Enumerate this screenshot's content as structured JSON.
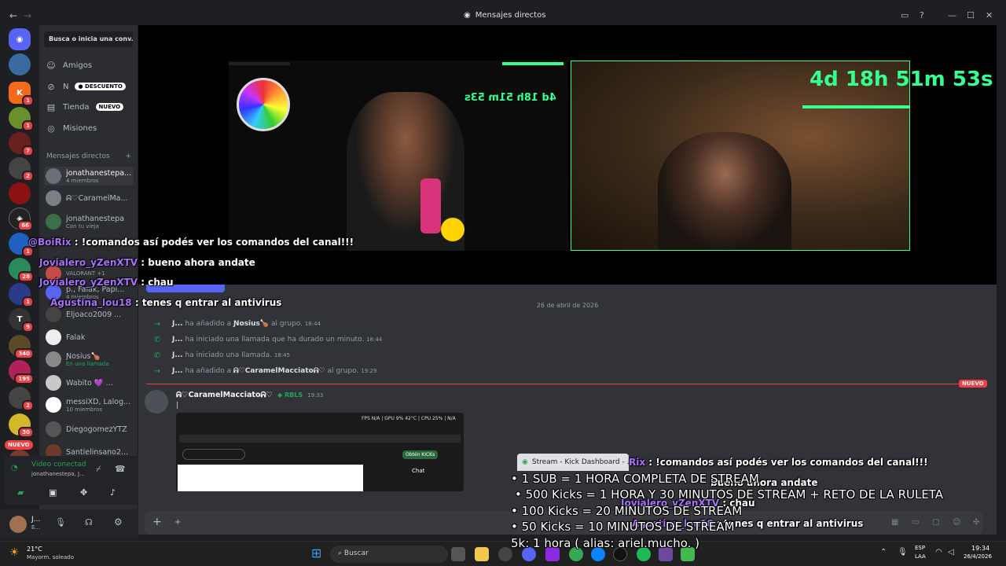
{
  "window": {
    "title": "Mensajes directos"
  },
  "sidebar": {
    "search_placeholder": "Busca o inicia una conv...",
    "nav": [
      {
        "label": "Amigos"
      },
      {
        "label": "N",
        "pill": "DESCUENTO"
      },
      {
        "label": "Tienda",
        "pill": "NUEVO"
      },
      {
        "label": "Misiones"
      }
    ],
    "dm_header": "Mensajes directos",
    "dm_add": "+",
    "dms": [
      {
        "name": "jonathanestepa...",
        "sub": "4 miembros"
      },
      {
        "name": "ᕱ♡CaramelMa..."
      },
      {
        "name": "jonathanestepa",
        "sub": "Con tu vieja"
      },
      {
        "name": "VALORANT +1"
      },
      {
        "name": "p., Falak, Papi...",
        "sub": "4 miembros"
      },
      {
        "name": "Eljoaco2009 ..."
      },
      {
        "name": "Falak"
      },
      {
        "name": "Ɲosius🍗",
        "sub": "En una llamada"
      },
      {
        "name": "Wabito 💜 ..."
      },
      {
        "name": "messiXD, Lalog...",
        "sub": "10 miembros"
      },
      {
        "name": "DiegogomezYTZ"
      },
      {
        "name": "Santielinsano2..."
      }
    ],
    "voice": {
      "title": "Video conectad",
      "sub": "jonathanestepa, J..."
    },
    "user": {
      "name": "J...",
      "status": "E..."
    }
  },
  "rail": {
    "badges": [
      "1",
      "1",
      "7",
      "2",
      "1",
      "66",
      "1",
      "28",
      "1",
      "9",
      "340",
      "195",
      "2",
      "30"
    ],
    "new_label": "NUEVO"
  },
  "stream": {
    "timer": "4d 18h 51m 53s",
    "timer_small": "4d 18h 51m 53s",
    "overlay_chat": [
      {
        "user": "@BoiRix",
        "text": ": !comandos así podés ver los comandos del canal!!!"
      },
      {
        "user": "Jovialero_yZenXTV",
        "text": ": bueno ahora andate"
      },
      {
        "user": "Jovialero_yZenXTV",
        "text": ": chau"
      },
      {
        "user": "Agustina_lou18",
        "text": ": tenes q entrar al antivirus"
      }
    ]
  },
  "chat": {
    "date": "26 de abril de 2026",
    "system": [
      {
        "who": "J...",
        "text": "ha añadido a",
        "target": "Ɲosius🍗",
        "tail": "al grupo.",
        "time": "18:44",
        "icon": "arrow-right-icon"
      },
      {
        "who": "J...",
        "text": "ha iniciado una llamada que ha durado un minuto.",
        "time": "18:44",
        "icon": "phone-icon"
      },
      {
        "who": "J...",
        "text": "ha iniciado una llamada.",
        "time": "18:45",
        "icon": "phone-icon"
      },
      {
        "who": "J...",
        "text": "ha añadido a",
        "target": "ᕱ♡CaramelMacciatoᕱ♡",
        "tail": "al grupo.",
        "time": "19:29",
        "icon": "arrow-right-icon"
      }
    ],
    "new_label": "NUEVO",
    "message": {
      "author": "ᕱ♡CaramelMacciatoᕱ♡",
      "tag": "RBLS",
      "time": "19:33",
      "text": "|"
    },
    "shot_labels": {
      "fps": "FPS N/A | GPU 9% 42°C | CPU 25% | N/A",
      "obtain": "Obtén KICKs",
      "chat": "Chat"
    }
  },
  "kick": {
    "tab_title": "Stream - Kick Dashboard - ...",
    "rules": [
      "• 1 SUB = 1 HORA COMPLETA DE STREAM",
      "• 500 Kicks = 1 HORA Y 30 MINUTOS DE STREAM + RETO DE LA RULETA",
      "• 100 Kicks = 20 MINUTOS DE STREAM",
      "• 50 Kicks = 10 MINUTOS DE STREAM",
      "5k: 1 hora ( alias: ariel.mucho. )"
    ],
    "chat_dupe": [
      {
        "user": "Rix",
        "text": ": !comandos así podés ver los comandos del canal!!!"
      },
      {
        "user": "",
        "text": "bueno ahora andate"
      },
      {
        "user": "Jovialero_yZenXTV",
        "text": ": chau"
      },
      {
        "user": "Agustina_lou18",
        "text": ": tenes q entrar al antivirus"
      }
    ]
  },
  "taskbar": {
    "weather_temp": "21°C",
    "weather_desc": "Mayorm. soleado",
    "search": "Buscar",
    "lang1": "ESP",
    "lang2": "LAA",
    "time": "19:34",
    "date": "26/4/2026"
  }
}
